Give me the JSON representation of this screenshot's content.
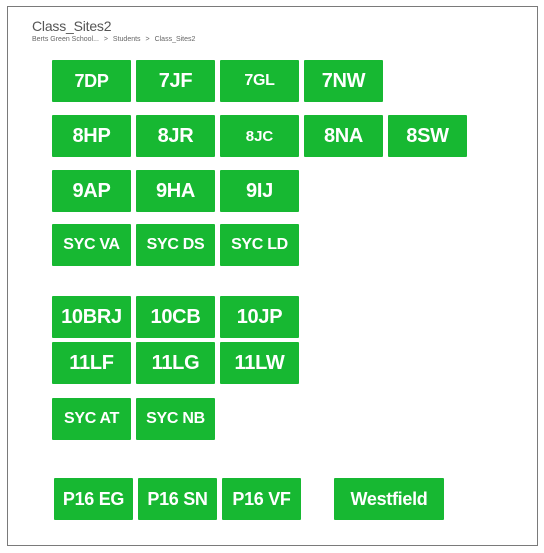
{
  "header": {
    "title": "Class_Sites2",
    "breadcrumb": [
      "Berts Green School...",
      ">",
      "Students",
      ">",
      "Class_Sites2"
    ]
  },
  "tiles": {
    "t7dp": "7DP",
    "t7jf": "7JF",
    "t7gl": "7GL",
    "t7nw": "7NW",
    "t8hp": "8HP",
    "t8jr": "8JR",
    "t8jc": "8JC",
    "t8na": "8NA",
    "t8sw": "8SW",
    "t9ap": "9AP",
    "t9ha": "9HA",
    "t9ij": "9IJ",
    "sycva": "SYC VA",
    "sycds": "SYC DS",
    "sycld": "SYC LD",
    "t10brj": "10BRJ",
    "t10cb": "10CB",
    "t10jp": "10JP",
    "t11lf": "11LF",
    "t11lg": "11LG",
    "t11lw": "11LW",
    "sycat": "SYC AT",
    "sycnb": "SYC NB",
    "p16eg": "P16 EG",
    "p16sn": "P16 SN",
    "p16vf": "P16 VF",
    "westfield": "Westfield"
  },
  "colors": {
    "tile": "#17b832",
    "tile_text": "#ffffff",
    "border": "#7a7a7a"
  }
}
